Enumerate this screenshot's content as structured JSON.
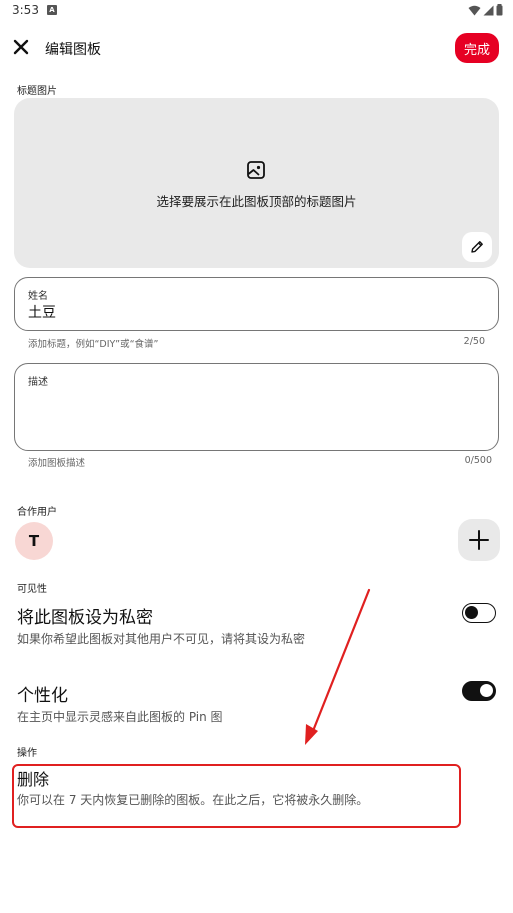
{
  "status_bar": {
    "time": "3:53",
    "notif_letter": "A"
  },
  "header": {
    "title": "编辑图板",
    "done_label": "完成"
  },
  "cover": {
    "label": "标题图片",
    "hint": "选择要展示在此图板顶部的标题图片"
  },
  "name_field": {
    "label": "姓名",
    "value": "土豆",
    "helper": "添加标题，例如“DIY”或“食谱”",
    "counter": "2/50"
  },
  "description_field": {
    "label": "描述",
    "value": "",
    "helper": "添加图板描述",
    "counter": "0/500"
  },
  "collaborators": {
    "label": "合作用户",
    "avatar_initial": "T"
  },
  "visibility": {
    "label": "可见性",
    "private": {
      "title": "将此图板设为私密",
      "description": "如果你希望此图板对其他用户不可见，请将其设为私密",
      "enabled": false
    },
    "personalize": {
      "title": "个性化",
      "description": "在主页中显示灵感来自此图板的 Pin 图",
      "enabled": true
    }
  },
  "actions": {
    "label": "操作",
    "delete": {
      "title": "删除",
      "description": "你可以在 7 天内恢复已删除的图板。在此之后，它将被永久删除。"
    }
  },
  "colors": {
    "accent": "#e60023",
    "annotation": "#e02020",
    "avatar_bg": "#f8d7d4"
  }
}
